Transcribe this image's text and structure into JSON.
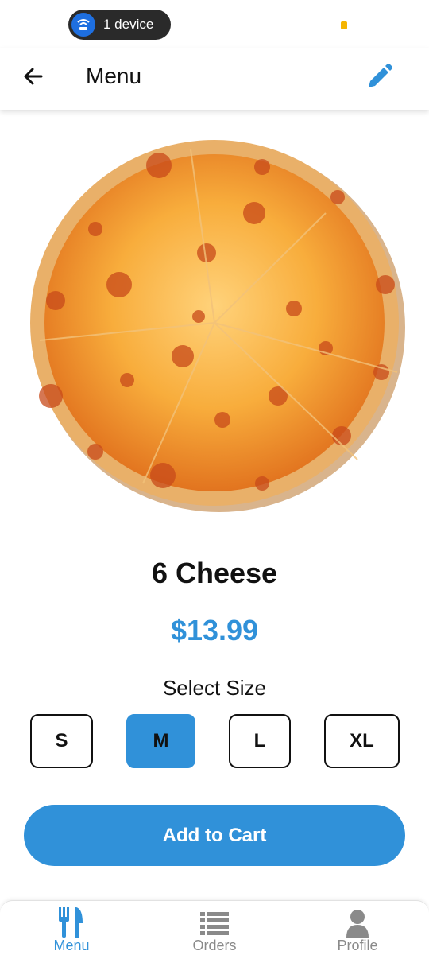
{
  "status_bar": {
    "device_label": "1 device",
    "icons": [
      "wifi-icon",
      "battery-indicator"
    ]
  },
  "app_bar": {
    "title": "Menu",
    "back_icon": "arrow-left-icon",
    "edit_icon": "pencil-icon"
  },
  "product": {
    "image": "pizza-image",
    "name": "6 Cheese",
    "price": "$13.99"
  },
  "size_selector": {
    "title": "Select Size",
    "options": [
      "S",
      "M",
      "L",
      "XL"
    ],
    "selected": "M"
  },
  "actions": {
    "add_to_cart": "Add to Cart"
  },
  "bottom_nav": {
    "items": [
      {
        "label": "Menu",
        "icon": "fork-knife-icon",
        "active": true
      },
      {
        "label": "Orders",
        "icon": "list-icon",
        "active": false
      },
      {
        "label": "Profile",
        "icon": "person-icon",
        "active": false
      }
    ]
  },
  "colors": {
    "accent": "#3091d9",
    "inactive": "#8a8a8a",
    "text": "#111111"
  }
}
